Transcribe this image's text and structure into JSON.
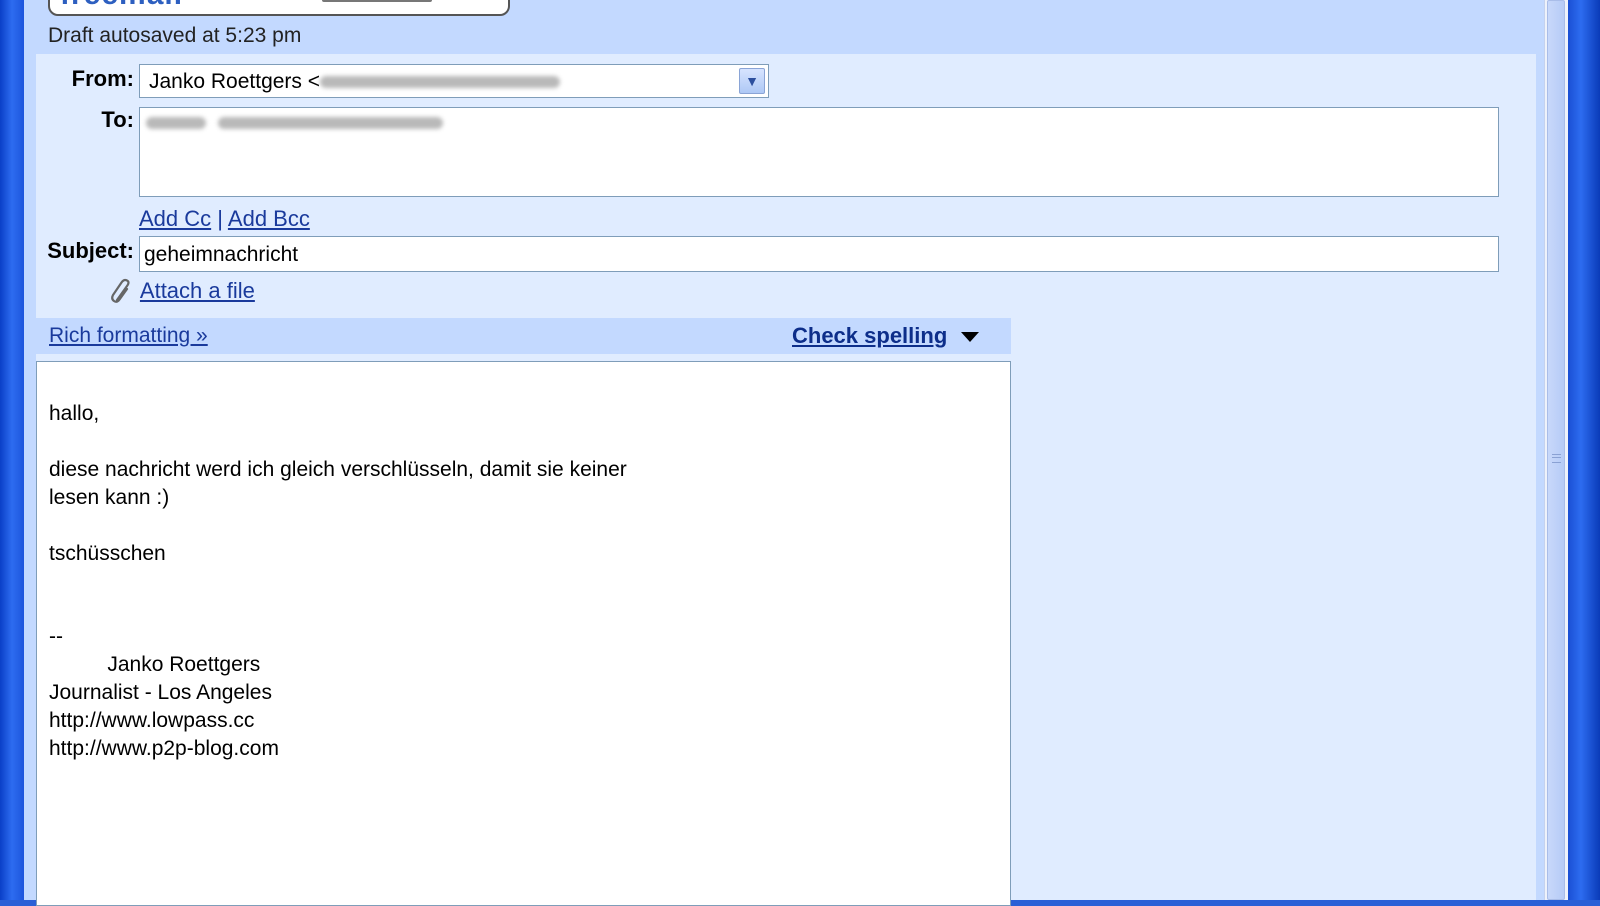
{
  "header": {
    "logo_text": "freemail",
    "autosave": "Draft autosaved at 5:23 pm"
  },
  "from": {
    "label": "From:",
    "value": "Janko Roettgers"
  },
  "to": {
    "label": "To:"
  },
  "cc": {
    "add_cc": "Add Cc",
    "separator": "|",
    "add_bcc": "Add Bcc"
  },
  "subject": {
    "label": "Subject:",
    "value": "geheimnachricht"
  },
  "attach": {
    "label": "Attach a file"
  },
  "toolbar": {
    "rich_formatting": "Rich formatting »",
    "check_spelling": "Check spelling"
  },
  "body": {
    "lines": [
      "hallo,",
      "diese nachricht werd ich gleich verschlüsseln, damit sie keiner",
      "lesen kann :)",
      "tschüsschen",
      "--",
      "          Janko Roettgers",
      "Journalist - Los Angeles",
      "http://www.lowpass.cc",
      "http://www.p2p-blog.com"
    ]
  },
  "icons": {
    "dropdown": "chevron-down-icon",
    "attach": "paperclip-icon",
    "spelling_menu": "triangle-down-icon"
  }
}
